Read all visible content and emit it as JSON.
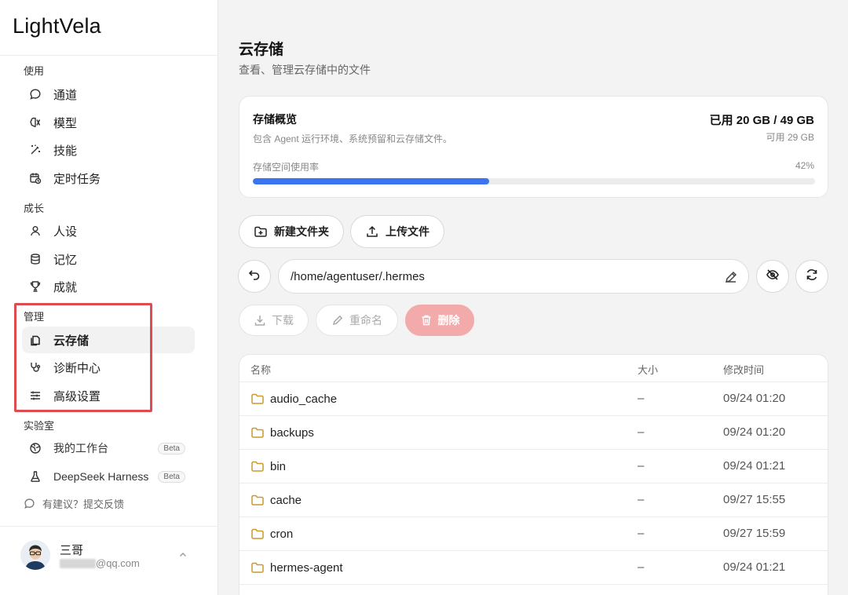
{
  "app": {
    "logo": "LightVela"
  },
  "sidebar": {
    "sections": {
      "use": "使用",
      "grow": "成长",
      "manage": "管理",
      "lab": "实验室"
    },
    "use_items": [
      {
        "label": "通道",
        "icon": "chat-bubble-icon"
      },
      {
        "label": "模型",
        "icon": "brain-icon"
      },
      {
        "label": "技能",
        "icon": "magic-wand-icon"
      },
      {
        "label": "定时任务",
        "icon": "calendar-clock-icon"
      }
    ],
    "grow_items": [
      {
        "label": "人设",
        "icon": "person-icon"
      },
      {
        "label": "记忆",
        "icon": "database-icon"
      },
      {
        "label": "成就",
        "icon": "trophy-icon"
      }
    ],
    "manage_items": [
      {
        "label": "云存储",
        "icon": "files-icon",
        "active": true
      },
      {
        "label": "诊断中心",
        "icon": "stethoscope-icon"
      },
      {
        "label": "高级设置",
        "icon": "sliders-icon"
      }
    ],
    "lab_items": [
      {
        "label": "我的工作台",
        "badge": "Beta",
        "icon": "globe-icon"
      },
      {
        "label": "DeepSeek Harness",
        "badge": "Beta",
        "icon": "flask-icon"
      }
    ],
    "feedback": "有建议？提交反馈",
    "user": {
      "name": "三哥",
      "email_suffix": "@qq.com"
    }
  },
  "main": {
    "title": "云存储",
    "subtitle": "查看、管理云存储中的文件",
    "storage": {
      "title": "存储概览",
      "description": "包含 Agent 运行环境、系统预留和云存储文件。",
      "used": "已用 20 GB / 49 GB",
      "available": "可用 29 GB",
      "usage_label": "存储空间使用率",
      "usage_percent": "42%",
      "usage_fraction": 0.42,
      "bar_color": "#3a74ee"
    },
    "buttons": {
      "new_folder": "新建文件夹",
      "upload": "上传文件",
      "download": "下载",
      "rename": "重命名",
      "delete": "删除"
    },
    "path": "/home/agentuser/.hermes",
    "table": {
      "headers": {
        "name": "名称",
        "size": "大小",
        "modified": "修改时间"
      },
      "rows": [
        {
          "name": "audio_cache",
          "size": "–",
          "modified": "09/24 01:20"
        },
        {
          "name": "backups",
          "size": "–",
          "modified": "09/24 01:20"
        },
        {
          "name": "bin",
          "size": "–",
          "modified": "09/24 01:21"
        },
        {
          "name": "cache",
          "size": "–",
          "modified": "09/27 15:55"
        },
        {
          "name": "cron",
          "size": "–",
          "modified": "09/27 15:59"
        },
        {
          "name": "hermes-agent",
          "size": "–",
          "modified": "09/24 01:21"
        }
      ]
    }
  },
  "colors": {
    "accent": "#3a74ee",
    "danger_soft": "#f2aaaa",
    "highlight": "#e14a4f",
    "folder": "#c99a2e"
  }
}
